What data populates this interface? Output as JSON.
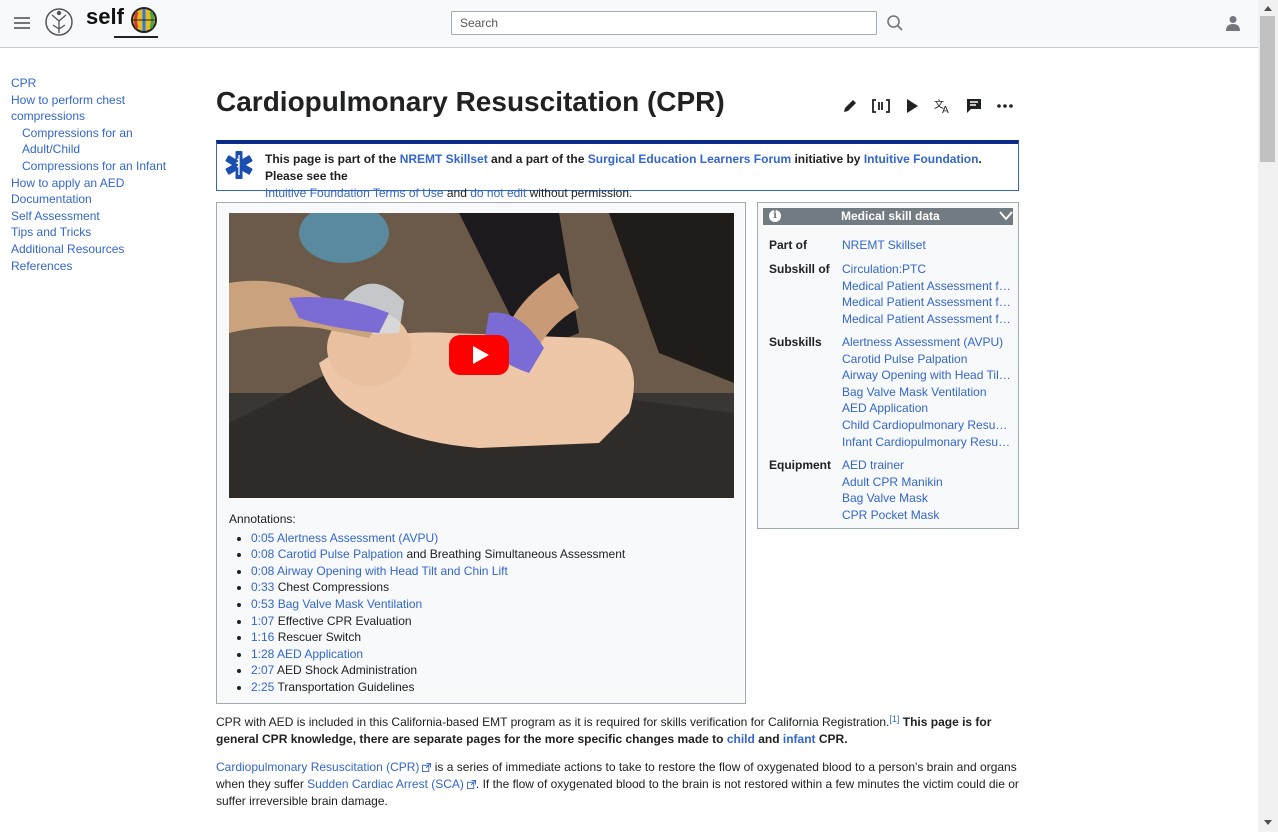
{
  "header": {
    "search_placeholder": "Search",
    "logo_text": "self"
  },
  "toc": [
    {
      "label": "CPR",
      "sub": false
    },
    {
      "label": "How to perform chest compressions",
      "sub": false
    },
    {
      "label": "Compressions for an Adult/Child",
      "sub": true
    },
    {
      "label": "Compressions for an Infant",
      "sub": true
    },
    {
      "label": "How to apply an AED",
      "sub": false
    },
    {
      "label": "Documentation",
      "sub": false
    },
    {
      "label": "Self Assessment",
      "sub": false
    },
    {
      "label": "Tips and Tricks",
      "sub": false
    },
    {
      "label": "Additional Resources",
      "sub": false
    },
    {
      "label": "References",
      "sub": false
    }
  ],
  "page": {
    "title": "Cardiopulmonary Resuscitation (CPR)",
    "actions": [
      "edit-icon",
      "source-icon",
      "play-icon",
      "translate-icon",
      "talk-icon",
      "more-icon"
    ]
  },
  "notice": {
    "t1": "This page is part of the ",
    "link1": "NREMT Skillset",
    "t2": " and a part of the ",
    "link2": "Surgical Education Learners Forum",
    "t3": " initiative by ",
    "link3": "Intuitive Foundation",
    "t4": ".   Please see the ",
    "link4": "Intuitive Foundation Terms of Use",
    "t5": " and ",
    "link5": "do not edit",
    "t6": " without permission."
  },
  "annotations": {
    "heading": "Annotations:",
    "items": [
      {
        "time": "0:05",
        "link": " Alertness Assessment (AVPU)",
        "text": ""
      },
      {
        "time": "0:08",
        "link": " Carotid Pulse Palpation",
        "text": " and Breathing Simultaneous Assessment"
      },
      {
        "time": "0:08",
        "link": " Airway Opening with Head Tilt and Chin Lift",
        "text": ""
      },
      {
        "time": "0:33",
        "link": "",
        "text": " Chest Compressions"
      },
      {
        "time": "0:53",
        "link": " Bag Valve Mask Ventilation",
        "text": ""
      },
      {
        "time": "1:07",
        "link": "",
        "text": " Effective CPR Evaluation"
      },
      {
        "time": "1:16",
        "link": "",
        "text": " Rescuer Switch"
      },
      {
        "time": "1:28",
        "link": " AED Application",
        "text": ""
      },
      {
        "time": "2:07",
        "link": "",
        "text": " AED Shock Administration"
      },
      {
        "time": "2:25",
        "link": "",
        "text": " Transportation Guidelines"
      }
    ]
  },
  "infobox": {
    "title": "Medical skill data",
    "rows": [
      {
        "label": "Part of",
        "values": [
          "NREMT Skillset"
        ]
      },
      {
        "label": "Subskill of",
        "values": [
          "Circulation:PTC",
          "Medical Patient Assessment for…",
          "Medical Patient Assessment for…",
          "Medical Patient Assessment for…"
        ]
      },
      {
        "label": "Subskills",
        "values": [
          "Alertness Assessment (AVPU)",
          "Carotid Pulse Palpation",
          "Airway Opening with Head Tilt …",
          "Bag Valve Mask Ventilation",
          "AED Application",
          "Child Cardiopulmonary Resusci…",
          "Infant Cardiopulmonary Resusc…"
        ]
      },
      {
        "label": "Equipment",
        "values": [
          "AED trainer",
          "Adult CPR Manikin",
          "Bag Valve Mask",
          "CPR Pocket Mask"
        ]
      }
    ]
  },
  "body": {
    "p1_t1": "CPR with AED is included in this California-based EMT program as it is required for skills verification for California Registration.",
    "p1_ref": "[1]",
    "p1_b1": " This page is for general CPR knowledge, there are separate pages for the more specific changes made to ",
    "p1_child": "child",
    "p1_b2": " and ",
    "p1_infant": "infant",
    "p1_b3": " CPR.",
    "p2_link1": "Cardiopulmonary Resuscitation (CPR)",
    "p2_t1": " is a series of immediate actions to take to restore the flow of oxygenated blood to a person's brain and organs when they suffer ",
    "p2_link2": "Sudden Cardiac Arrest (SCA)",
    "p2_t2": ". If the flow of oxygenated blood to the brain is not restored within a few minutes the victim could die or suffer irreversible brain damage."
  },
  "colors": {
    "link": "#3366cc",
    "notice_border": "#0b2a8a",
    "youtube_red": "#ff0000",
    "infobox_header": "#727a82"
  }
}
